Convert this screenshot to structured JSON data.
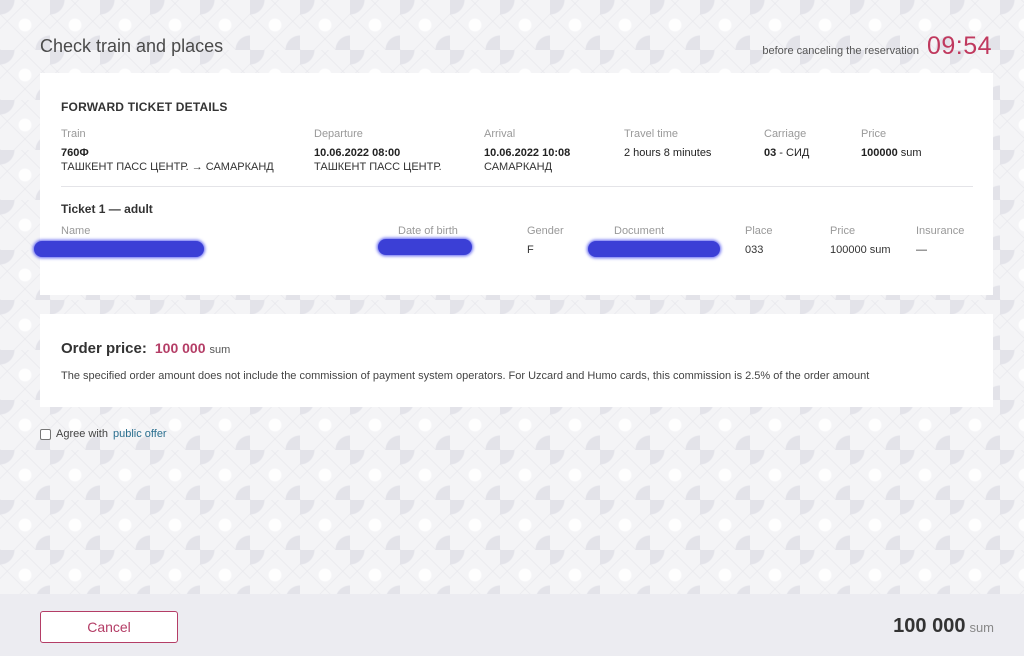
{
  "header": {
    "title": "Check train and places",
    "timer_label": "before canceling the reservation",
    "timer_value": "09:54"
  },
  "forward": {
    "section_title": "FORWARD TICKET DETAILS",
    "train": {
      "label": "Train",
      "number": "760Ф",
      "route": "ТАШКЕНТ ПАСС ЦЕНТР. → САМАРКАНД"
    },
    "departure": {
      "label": "Departure",
      "datetime": "10.06.2022 08:00",
      "station": "ТАШКЕНТ ПАСС ЦЕНТР."
    },
    "arrival": {
      "label": "Arrival",
      "datetime": "10.06.2022 10:08",
      "station": "САМАРКАНД"
    },
    "travel_time": {
      "label": "Travel time",
      "value": "2 hours 8 minutes"
    },
    "carriage": {
      "label": "Carriage",
      "value": "03",
      "type": " - СИД"
    },
    "price": {
      "label": "Price",
      "value": "100000",
      "unit": " sum"
    }
  },
  "ticket": {
    "title": "Ticket 1 — adult",
    "columns": {
      "name": "Name",
      "dob": "Date of birth",
      "gender": "Gender",
      "document": "Document",
      "place": "Place",
      "price": "Price",
      "insurance": "Insurance"
    },
    "values": {
      "gender": "F",
      "place": "033",
      "price": "100000 sum",
      "insurance": "—"
    },
    "redaction_color": "#3b3fd6"
  },
  "order": {
    "label": "Order price:",
    "amount": "100 000",
    "unit": "sum",
    "note": "The specified order amount does not include the commission of payment system operators. For Uzcard and Humo cards, this commission is 2.5% of the order amount"
  },
  "agree": {
    "checked": false,
    "text": "Agree with ",
    "link": "public offer"
  },
  "footer": {
    "cancel_label": "Cancel",
    "total_amount": "100 000",
    "total_unit": "sum"
  },
  "colors": {
    "accent": "#b43d66",
    "timer": "#c0395e",
    "link": "#2a6f8f"
  }
}
